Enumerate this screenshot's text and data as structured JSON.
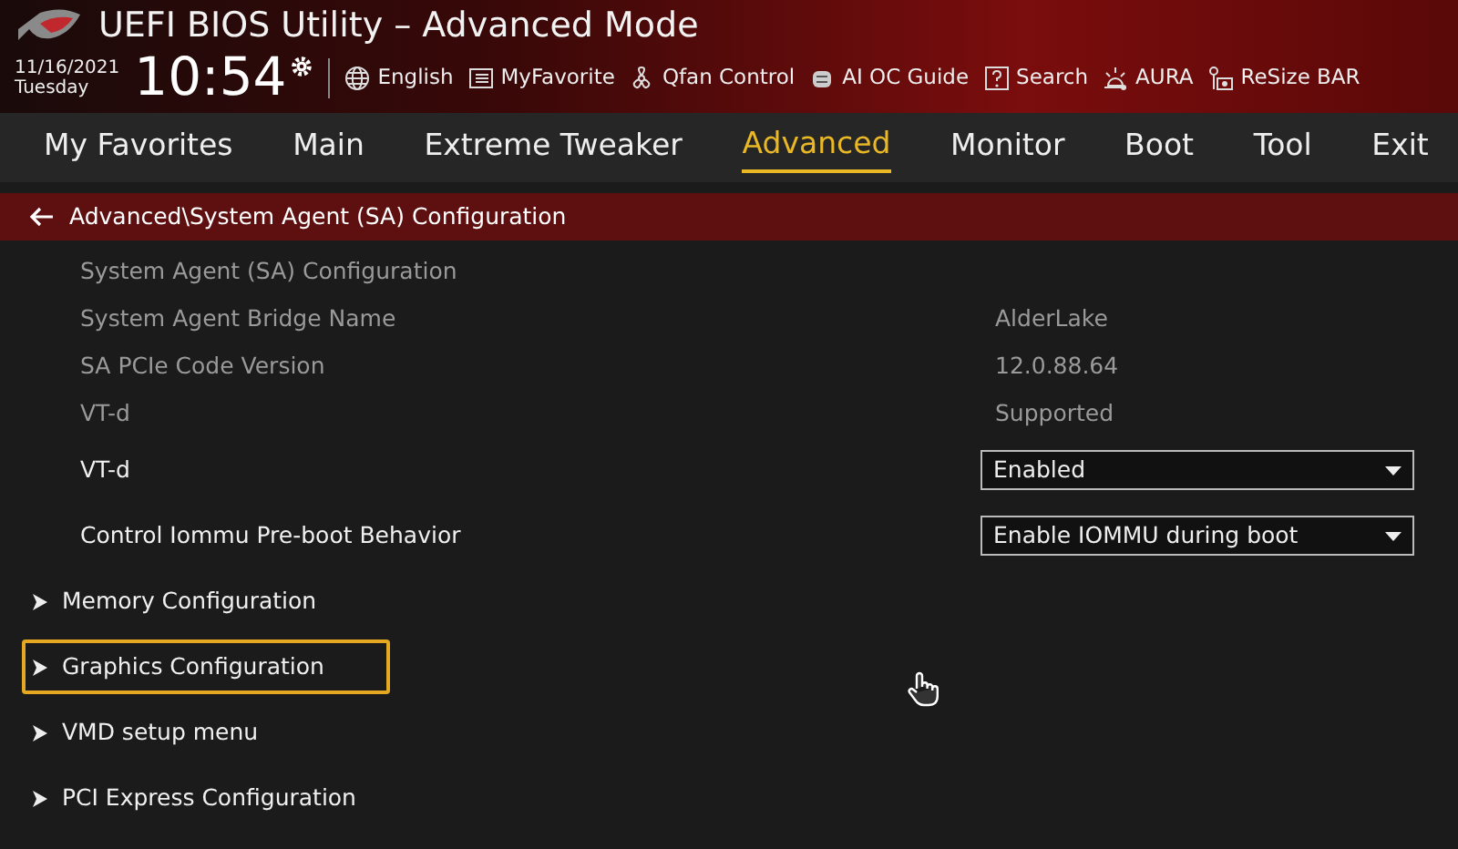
{
  "window": {
    "title": "UEFI BIOS Utility – Advanced Mode"
  },
  "clock": {
    "date": "11/16/2021",
    "day": "Tuesday",
    "time": "10:54"
  },
  "toolbar": [
    {
      "label": "English",
      "kind": "globe"
    },
    {
      "label": "MyFavorite",
      "kind": "folder"
    },
    {
      "label": "Qfan Control",
      "kind": "fan"
    },
    {
      "label": "AI OC Guide",
      "kind": "chip"
    },
    {
      "label": "Search",
      "kind": "help"
    },
    {
      "label": "AURA",
      "kind": "light"
    },
    {
      "label": "ReSize BAR",
      "kind": "card"
    }
  ],
  "tabs": [
    {
      "label": "My Favorites",
      "selected": false
    },
    {
      "label": "Main",
      "selected": false
    },
    {
      "label": "Extreme Tweaker",
      "selected": false
    },
    {
      "label": "Advanced",
      "selected": true
    },
    {
      "label": "Monitor",
      "selected": false
    },
    {
      "label": "Boot",
      "selected": false
    },
    {
      "label": "Tool",
      "selected": false
    },
    {
      "label": "Exit",
      "selected": false
    }
  ],
  "breadcrumb": "Advanced\\System Agent (SA) Configuration",
  "rows": [
    {
      "kind": "header",
      "label": "System Agent (SA) Configuration"
    },
    {
      "kind": "info",
      "label": "System Agent Bridge Name",
      "value": "AlderLake"
    },
    {
      "kind": "info",
      "label": "SA PCIe Code Version",
      "value": "12.0.88.64"
    },
    {
      "kind": "info",
      "label": "VT-d",
      "value": "Supported"
    },
    {
      "kind": "setting",
      "label": "VT-d",
      "value": "Enabled"
    },
    {
      "kind": "setting",
      "label": "Control Iommu Pre-boot Behavior",
      "value": "Enable IOMMU during boot"
    },
    {
      "kind": "submenu",
      "label": "Memory Configuration",
      "selected": false
    },
    {
      "kind": "submenu",
      "label": "Graphics Configuration",
      "selected": true
    },
    {
      "kind": "submenu",
      "label": "VMD setup menu",
      "selected": false
    },
    {
      "kind": "submenu",
      "label": "PCI Express Configuration",
      "selected": false
    }
  ]
}
